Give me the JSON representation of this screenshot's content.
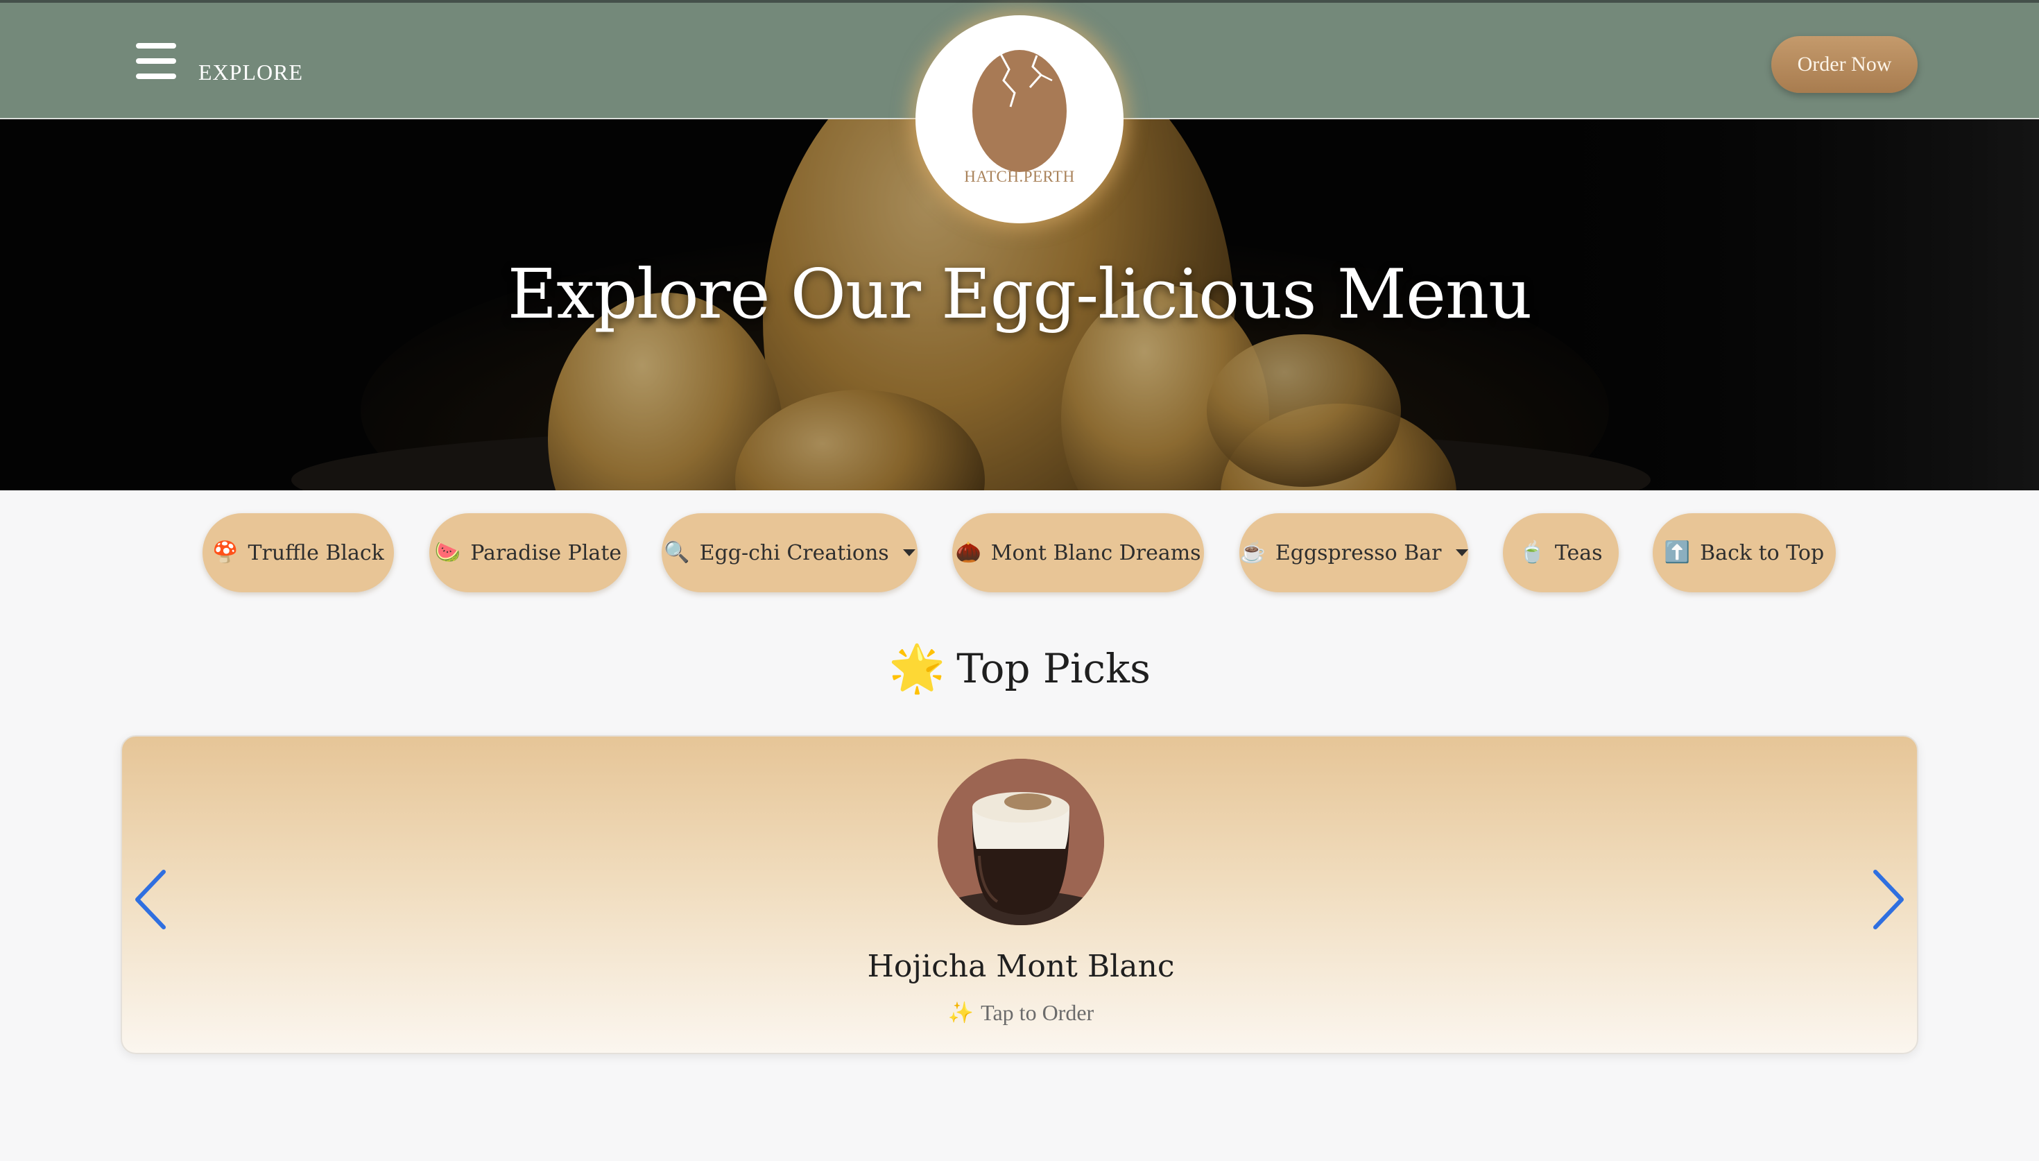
{
  "header": {
    "menu_label": "EXPLORE",
    "order_button": "Order Now",
    "logo_text": "HATCH.PERTH"
  },
  "hero": {
    "title": "Explore Our Egg-licious Menu"
  },
  "categories": [
    {
      "icon": "🍄",
      "label": "Truffle Black",
      "dropdown": false
    },
    {
      "icon": "🍉",
      "label": "Paradise Plate",
      "dropdown": false
    },
    {
      "icon": "🔍",
      "label": "Egg-chi Creations",
      "dropdown": true
    },
    {
      "icon": "🌰",
      "label": "Mont Blanc Dreams",
      "dropdown": false
    },
    {
      "icon": "☕",
      "label": "Eggspresso Bar",
      "dropdown": true
    },
    {
      "icon": "🍵",
      "label": "Teas",
      "dropdown": false
    },
    {
      "icon": "⬆️",
      "label": "Back to Top",
      "dropdown": false
    }
  ],
  "top_picks": {
    "icon": "🌟",
    "heading": "Top Picks",
    "items": [
      {
        "name": "Hojicha Mont Blanc",
        "cta_icon": "✨",
        "cta": "Tap to Order"
      }
    ]
  },
  "colors": {
    "topbar": "#74897a",
    "pill": "#e8c596",
    "order_button": "#b38659",
    "arrow": "#2f6fe0"
  }
}
